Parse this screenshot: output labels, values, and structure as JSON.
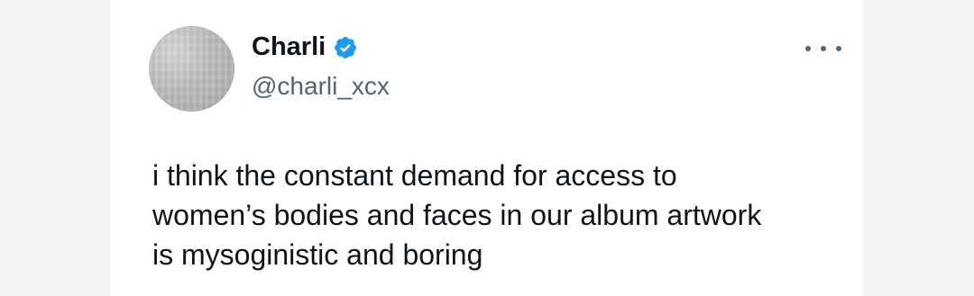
{
  "tweet": {
    "display_name": "Charli",
    "handle": "@charli_xcx",
    "verified": true,
    "text": "i think the constant demand for access to\nwomen’s bodies and faces in our album artwork\nis mysoginistic and boring"
  },
  "icons": {
    "verified": "verified-badge-icon",
    "more": "more-options-icon",
    "avatar": "profile-avatar"
  },
  "colors": {
    "text_primary": "#0f1419",
    "text_secondary": "#536471",
    "verified_blue": "#1d9bf0",
    "background": "#ffffff",
    "page_background": "#f4f4f4"
  }
}
